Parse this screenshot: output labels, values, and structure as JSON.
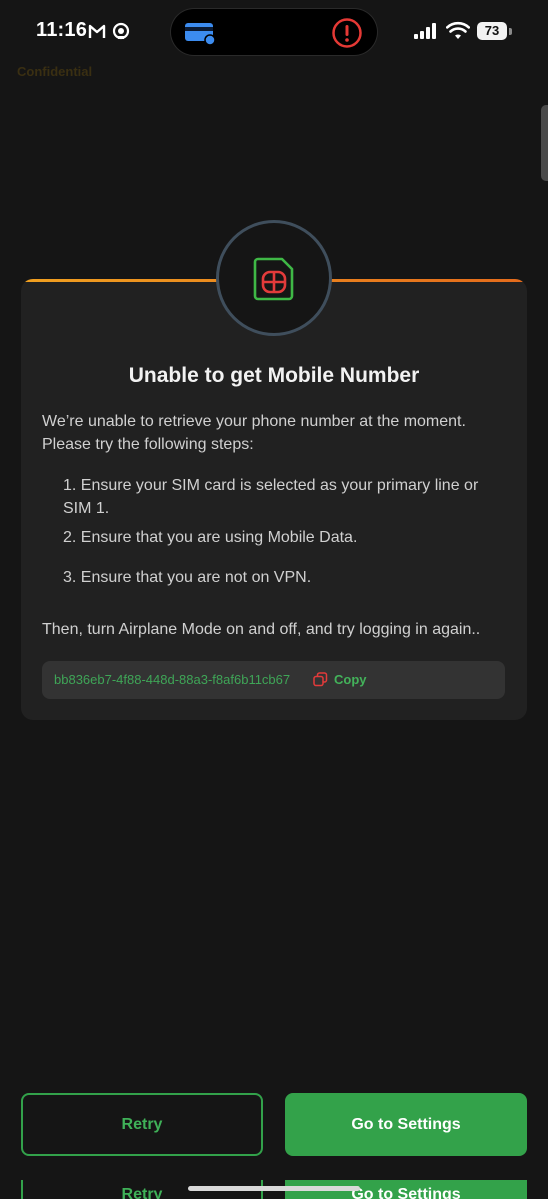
{
  "status_bar": {
    "time": "11:16",
    "battery": "73",
    "icons": [
      "gmail-icon",
      "headset-icon",
      "credit-card-icon",
      "alert-icon",
      "cellular-signal-icon",
      "wifi-icon",
      "battery-icon"
    ]
  },
  "watermark": "Confidential",
  "card": {
    "title": "Unable to get Mobile Number",
    "intro_line1": "We’re unable to retrieve your phone number at the moment.",
    "intro_line2": "Please try the following steps:",
    "steps": [
      {
        "line1": "1. Ensure your SIM card is selected as your primary line or",
        "line2": "SIM 1."
      },
      {
        "line1": "2. Ensure that you are using Mobile Data."
      },
      {
        "line1": "3. Ensure that you are not on VPN."
      }
    ],
    "outro": "Then, turn Airplane Mode on and off, and try logging in again..",
    "reference_id": "bb836eb7-4f88-448d-88a3-f8af6b11cb67",
    "copy_label": "Copy",
    "icon": "sim-card-icon"
  },
  "buttons": {
    "retry": "Retry",
    "settings": "Go to Settings"
  },
  "colors": {
    "background": "#151515",
    "card": "#212121",
    "accent_green": "#33a24a",
    "accent_orange": "#f0a020",
    "sim_icon_green": "#3fb846",
    "sim_icon_red": "#e33b3b",
    "alert_red": "#e53935",
    "card_blue": "#3c8cf0"
  }
}
